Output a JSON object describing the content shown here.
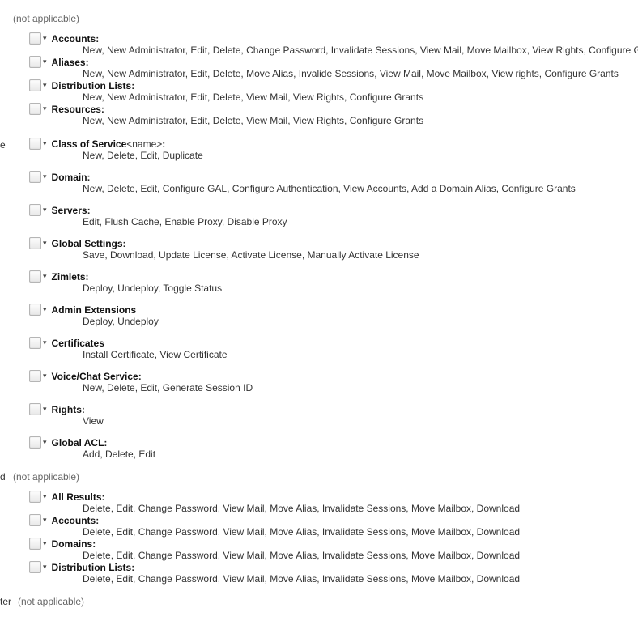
{
  "na_label": "(not applicable)",
  "left_fragments": {
    "e": "e",
    "d": "d",
    "ter": "ter"
  },
  "group1": [
    {
      "key": "accounts",
      "title": "Accounts",
      "suffix": "",
      "colon": ":",
      "ops": "New, New Administrator, Edit, Delete, Change Password, Invalidate Sessions, View Mail, Move Mailbox, View Rights, Configure Gra"
    },
    {
      "key": "aliases",
      "title": "Aliases",
      "suffix": "",
      "colon": ":",
      "ops": "New, New Administrator, Edit, Delete, Move Alias, Invalide Sessions, View Mail, Move Mailbox, View rights, Configure Grants"
    },
    {
      "key": "distlists",
      "title": "Distribution Lists",
      "suffix": "",
      "colon": ":",
      "ops": "New, New Administrator, Edit, Delete, View Mail, View Rights, Configure Grants"
    },
    {
      "key": "resources",
      "title": "Resources",
      "suffix": "",
      "colon": ":",
      "ops": "New, New Administrator, Edit, Delete, View Mail, View Rights, Configure Grants"
    }
  ],
  "group2": [
    {
      "key": "cos",
      "title": "Class of Service",
      "suffix": " <name>",
      "colon": ":",
      "ops": "New, Delete, Edit, Duplicate"
    },
    {
      "key": "domain",
      "title": "Domain",
      "suffix": "",
      "colon": ":",
      "ops": "New, Delete, Edit, Configure GAL, Configure Authentication, View Accounts, Add a Domain Alias, Configure Grants"
    },
    {
      "key": "servers",
      "title": "Servers",
      "suffix": "",
      "colon": ":",
      "ops": "Edit, Flush Cache, Enable Proxy, Disable Proxy"
    },
    {
      "key": "gsettings",
      "title": "Global Settings",
      "suffix": "",
      "colon": ":",
      "ops": "Save, Download, Update License, Activate License, Manually Activate License"
    },
    {
      "key": "zimlets",
      "title": "Zimlets",
      "suffix": "",
      "colon": ":",
      "ops": "Deploy, Undeploy, Toggle Status"
    },
    {
      "key": "adminext",
      "title": "Admin Extensions",
      "suffix": "",
      "colon": "",
      "ops": "Deploy, Undeploy"
    },
    {
      "key": "certs",
      "title": "Certificates",
      "suffix": "",
      "colon": "",
      "ops": "Install Certificate, View Certificate"
    },
    {
      "key": "voicechat",
      "title": "Voice/Chat Service",
      "suffix": "",
      "colon": ":",
      "ops": "New, Delete, Edit, Generate Session ID"
    },
    {
      "key": "rights",
      "title": "Rights",
      "suffix": "",
      "colon": ":",
      "ops": "View"
    },
    {
      "key": "gacl",
      "title": "Global ACL",
      "suffix": "",
      "colon": ":",
      "ops": "Add, Delete, Edit"
    }
  ],
  "group3": [
    {
      "key": "allresults",
      "title": "All Results",
      "suffix": "",
      "colon": ":",
      "ops": "Delete, Edit, Change Password, View Mail, Move Alias, Invalidate Sessions, Move Mailbox, Download"
    },
    {
      "key": "accounts2",
      "title": "Accounts",
      "suffix": "",
      "colon": ":",
      "ops": "Delete, Edit, Change Password, View Mail, Move Alias, Invalidate Sessions, Move Mailbox, Download"
    },
    {
      "key": "domains2",
      "title": "Domains",
      "suffix": "",
      "colon": ":",
      "ops": "Delete, Edit, Change Password, View Mail, Move Alias, Invalidate Sessions, Move Mailbox, Download"
    },
    {
      "key": "distlists2",
      "title": "Distribution Lists",
      "suffix": "",
      "colon": ":",
      "ops": "Delete, Edit, Change Password, View Mail, Move Alias, Invalidate Sessions, Move Mailbox, Download"
    }
  ]
}
